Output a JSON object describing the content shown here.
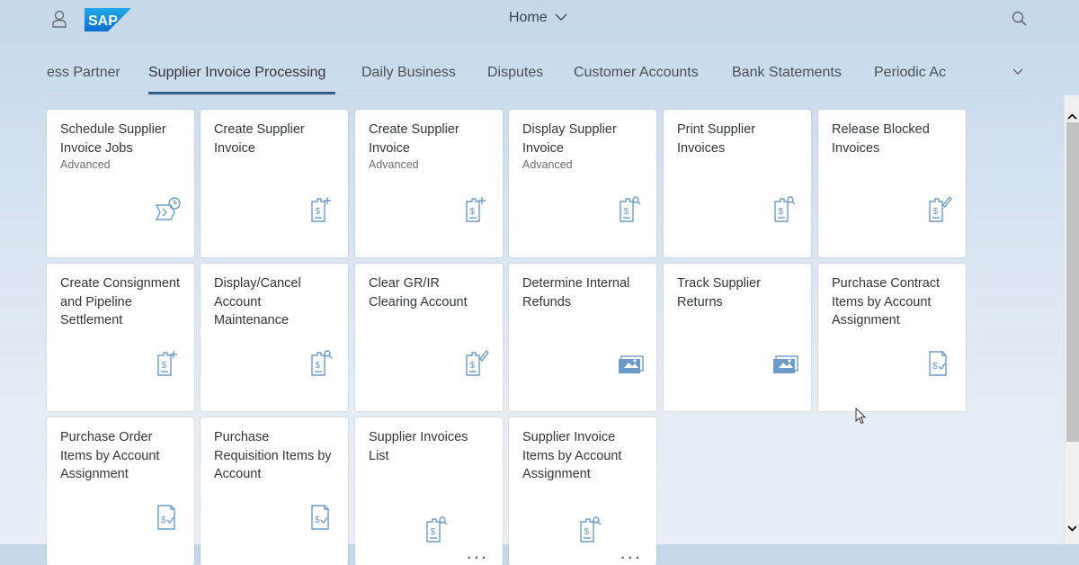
{
  "header": {
    "title": "Home",
    "logo_text": "SAP",
    "user_icon": "user-icon",
    "search_icon": "search-icon"
  },
  "tabs": [
    {
      "label": "ess Partner",
      "active": false
    },
    {
      "label": "Supplier Invoice Processing",
      "active": true
    },
    {
      "label": "Daily Business",
      "active": false
    },
    {
      "label": "Disputes",
      "active": false
    },
    {
      "label": "Customer Accounts",
      "active": false
    },
    {
      "label": "Bank Statements",
      "active": false
    },
    {
      "label": "Periodic Ac",
      "active": false
    }
  ],
  "tiles": [
    {
      "title": "Schedule Supplier Invoice Jobs",
      "subtitle": "Advanced",
      "icon": "scheduled-jobs-icon"
    },
    {
      "title": "Create Supplier Invoice",
      "subtitle": "",
      "icon": "create-invoice-icon"
    },
    {
      "title": "Create Supplier Invoice",
      "subtitle": "Advanced",
      "icon": "create-invoice-icon"
    },
    {
      "title": "Display Supplier Invoice",
      "subtitle": "Advanced",
      "icon": "display-invoice-icon"
    },
    {
      "title": "Print Supplier Invoices",
      "subtitle": "",
      "icon": "display-invoice-icon"
    },
    {
      "title": "Release Blocked Invoices",
      "subtitle": "",
      "icon": "edit-invoice-icon"
    },
    {
      "title": "Create Consignment and Pipeline Settlement",
      "subtitle": "",
      "icon": "create-invoice-icon"
    },
    {
      "title": "Display/Cancel Account Maintenance",
      "subtitle": "",
      "icon": "display-invoice-icon"
    },
    {
      "title": "Clear GR/IR Clearing Account",
      "subtitle": "",
      "icon": "edit-invoice-icon"
    },
    {
      "title": "Determine Internal Refunds",
      "subtitle": "",
      "icon": "image-transfer-icon"
    },
    {
      "title": "Track Supplier Returns",
      "subtitle": "",
      "icon": "image-transfer-icon"
    },
    {
      "title": "Purchase Contract Items by Account Assignment",
      "subtitle": "",
      "icon": "verified-invoice-icon"
    },
    {
      "title": "Purchase Order Items by Account Assignment",
      "subtitle": "",
      "icon": "verified-invoice-icon"
    },
    {
      "title": "Purchase Requisition Items by Account",
      "subtitle": "",
      "icon": "verified-invoice-icon"
    },
    {
      "title": "Supplier Invoices List",
      "subtitle": "",
      "icon": "display-invoice-icon",
      "more": "..."
    },
    {
      "title": "Supplier Invoice Items by Account Assignment",
      "subtitle": "",
      "icon": "display-invoice-icon",
      "more": "..."
    }
  ],
  "colors": {
    "accent": "#346187",
    "icon": "#6c9bc7",
    "tile_bg": "#ffffff"
  }
}
